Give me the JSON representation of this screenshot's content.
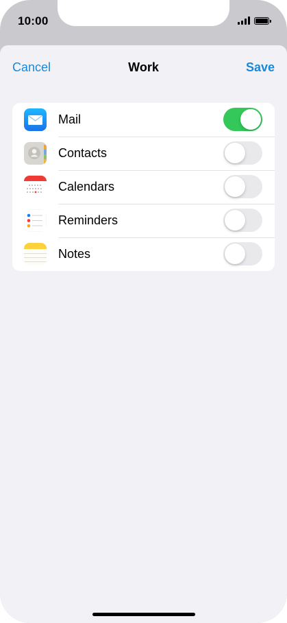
{
  "status_bar": {
    "time": "10:00",
    "icons": [
      "cellular-signal-icon",
      "battery-icon"
    ]
  },
  "nav": {
    "cancel_label": "Cancel",
    "title": "Work",
    "save_label": "Save"
  },
  "accounts": {
    "items": [
      {
        "label": "Mail",
        "icon": "mail-app-icon",
        "enabled": true
      },
      {
        "label": "Contacts",
        "icon": "contacts-app-icon",
        "enabled": false
      },
      {
        "label": "Calendars",
        "icon": "calendar-app-icon",
        "enabled": false
      },
      {
        "label": "Reminders",
        "icon": "reminders-app-icon",
        "enabled": false
      },
      {
        "label": "Notes",
        "icon": "notes-app-icon",
        "enabled": false
      }
    ]
  },
  "colors": {
    "accent": "#1a88da",
    "toggle_on": "#34c759",
    "toggle_off": "#e9e9eb",
    "background": "#f1f1f6"
  }
}
